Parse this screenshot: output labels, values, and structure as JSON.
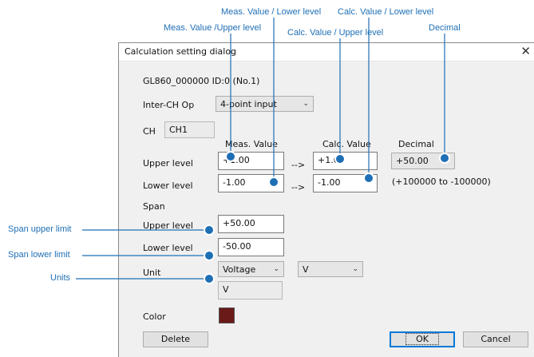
{
  "callouts": {
    "meas_lower": "Meas. Value / Lower level",
    "calc_lower": "Calc. Value / Lower level",
    "meas_upper": "Meas. Value /Upper level",
    "calc_upper": "Calc. Value / Upper level",
    "decimal": "Decimal",
    "span_upper_limit": "Span upper limit",
    "span_lower_limit": "Span lower limit",
    "units": "Units"
  },
  "dialog": {
    "title": "Calculation setting dialog",
    "close_glyph": "✕",
    "device_id": "GL860_000000 ID:0 (No.1)",
    "inter_ch_label": "Inter-CH Op",
    "inter_ch_value": "4-point input",
    "ch_label": "CH",
    "ch_value": "CH1",
    "col_meas": "Meas. Value",
    "col_calc": "Calc. Value",
    "col_decimal": "Decimal",
    "upper_label": "Upper level",
    "lower_label": "Lower level",
    "meas_upper": "+1.00",
    "meas_lower": "-1.00",
    "calc_upper": "+1.00",
    "calc_lower": "-1.00",
    "arrow": "-->",
    "decimal_value": "+50.00",
    "decimal_range": "(+100000 to -100000)",
    "span_label": "Span",
    "span_upper_label": "Upper level",
    "span_lower_label": "Lower level",
    "span_upper": "+50.00",
    "span_lower": "-50.00",
    "unit_label": "Unit",
    "unit_type": "Voltage",
    "unit_symbol": "V",
    "unit_display": "V",
    "color_label": "Color",
    "color_value": "#6b1a1a",
    "delete_button": "Delete",
    "ok_button": "OK",
    "cancel_button": "Cancel"
  },
  "colors": {
    "callout": "#1f6fb5"
  }
}
